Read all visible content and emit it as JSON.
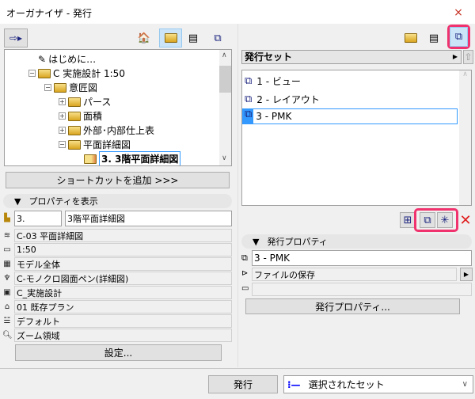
{
  "window": {
    "title": "オーガナイザ - 発行",
    "close": "×"
  },
  "left": {
    "tree": [
      {
        "label": "はじめに…"
      },
      {
        "label": "C  実施設計  1:50"
      },
      {
        "label": "意匠図"
      },
      {
        "label": "パース"
      },
      {
        "label": "面積"
      },
      {
        "label": "外部･内部仕上表"
      },
      {
        "label": "平面詳細図"
      },
      {
        "label": "3. 3階平面詳細図"
      }
    ],
    "add_shortcut": "ショートカットを追加 >>>",
    "props_header": "プロパティを表示",
    "id": "3.",
    "name": "3階平面詳細図",
    "rows": [
      "C-03 平面詳細図",
      "1:50",
      "モデル全体",
      "C-モノクロ図面ペン(詳細図)",
      "C_実施設計",
      "01 既存プラン",
      "デフォルト",
      "ズーム領域"
    ],
    "settings": "設定..."
  },
  "right": {
    "set_header": "発行セット",
    "sets": [
      "1 - ビュー",
      "2 - レイアウト",
      "3 - PMK"
    ],
    "props_header": "発行プロパティ",
    "set_name": "3 - PMK",
    "method": "ファイルの保存",
    "path": "",
    "props_button": "発行プロパティ..."
  },
  "bottom": {
    "publish": "発行",
    "scope": "選択されたセット"
  }
}
